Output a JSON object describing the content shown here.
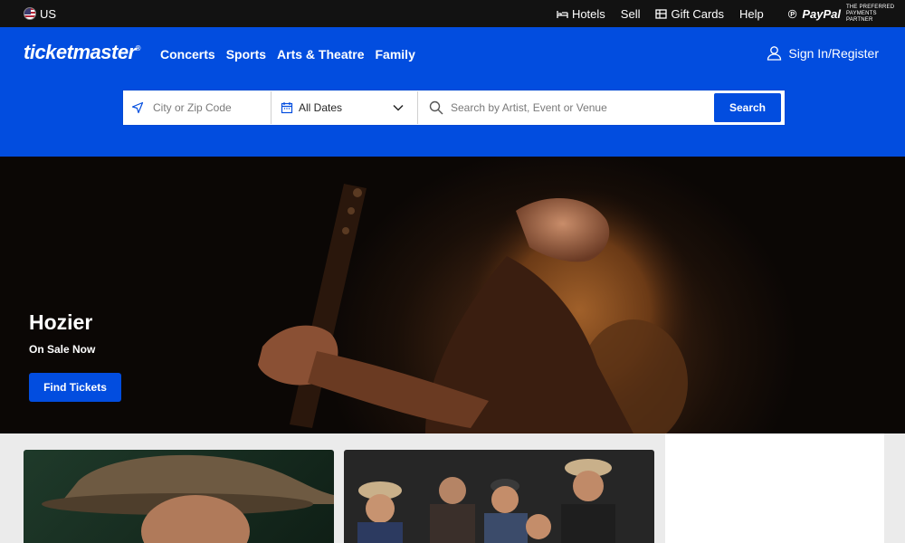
{
  "utility": {
    "region": "US",
    "links": [
      "Hotels",
      "Sell",
      "Gift Cards",
      "Help"
    ],
    "paypal_word": "PayPal",
    "paypal_tagline": "The Preferred Payments Partner"
  },
  "header": {
    "logo": "ticketmaster",
    "logo_mark": "®",
    "nav": [
      "Concerts",
      "Sports",
      "Arts & Theatre",
      "Family"
    ],
    "signin": "Sign In/Register"
  },
  "search": {
    "location_placeholder": "City or Zip Code",
    "dates_label": "All Dates",
    "query_placeholder": "Search by Artist, Event or Venue",
    "button": "Search"
  },
  "hero": {
    "title": "Hozier",
    "subtitle": "On Sale Now",
    "button": "Find Tickets"
  },
  "colors": {
    "brand_blue": "#024ddf",
    "utility_bg": "#121212"
  }
}
